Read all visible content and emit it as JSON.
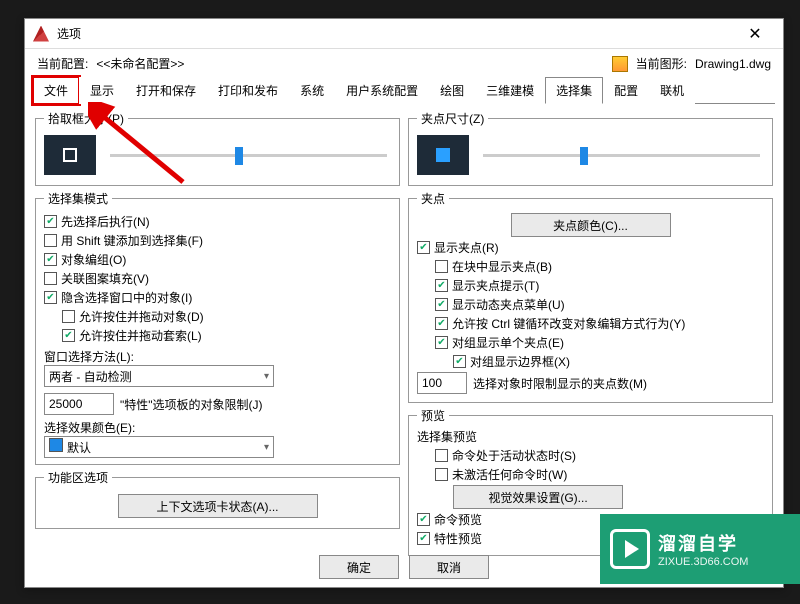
{
  "title": "选项",
  "header": {
    "profile_label": "当前配置:",
    "profile_value": "<<未命名配置>>",
    "drawing_label": "当前图形:",
    "drawing_value": "Drawing1.dwg"
  },
  "tabs": [
    "文件",
    "显示",
    "打开和保存",
    "打印和发布",
    "系统",
    "用户系统配置",
    "绘图",
    "三维建模",
    "选择集",
    "配置",
    "联机"
  ],
  "active_tab": "选择集",
  "highlight_tab": "文件",
  "left": {
    "pickbox_legend": "拾取框大小(P)",
    "mode_legend": "选择集模式",
    "mode_items": [
      {
        "checked": true,
        "label": "先选择后执行(N)"
      },
      {
        "checked": false,
        "label": "用 Shift 键添加到选择集(F)"
      },
      {
        "checked": true,
        "label": "对象编组(O)"
      },
      {
        "checked": false,
        "label": "关联图案填充(V)"
      },
      {
        "checked": true,
        "label": "隐含选择窗口中的对象(I)"
      }
    ],
    "mode_sub": [
      {
        "checked": false,
        "label": "允许按住并拖动对象(D)"
      },
      {
        "checked": true,
        "label": "允许按住并拖动套索(L)"
      }
    ],
    "winsel_label": "窗口选择方法(L):",
    "winsel_value": "两者 - 自动检测",
    "limit_value": "25000",
    "limit_label": "\"特性\"选项板的对象限制(J)",
    "effect_label": "选择效果颜色(E):",
    "effect_value": "默认",
    "ribbon_legend": "功能区选项",
    "ribbon_btn": "上下文选项卡状态(A)..."
  },
  "right": {
    "gripsize_legend": "夹点尺寸(Z)",
    "grip_legend": "夹点",
    "grip_color_btn": "夹点颜色(C)...",
    "grip_items": [
      {
        "checked": true,
        "label": "显示夹点(R)"
      },
      {
        "checked": false,
        "label": "在块中显示夹点(B)",
        "indent": true
      },
      {
        "checked": true,
        "label": "显示夹点提示(T)",
        "indent": true
      },
      {
        "checked": true,
        "label": "显示动态夹点菜单(U)",
        "indent": true
      },
      {
        "checked": true,
        "label": "允许按 Ctrl 键循环改变对象编辑方式行为(Y)",
        "indent": true
      },
      {
        "checked": true,
        "label": "对组显示单个夹点(E)",
        "indent": true
      },
      {
        "checked": true,
        "label": "对组显示边界框(X)",
        "indent": true,
        "extra_indent": true
      }
    ],
    "grip_limit_value": "100",
    "grip_limit_label": "选择对象时限制显示的夹点数(M)",
    "preview_legend": "预览",
    "preview_sub": "选择集预览",
    "preview_items": [
      {
        "checked": false,
        "label": "命令处于活动状态时(S)"
      },
      {
        "checked": false,
        "label": "未激活任何命令时(W)"
      }
    ],
    "visual_btn": "视觉效果设置(G)...",
    "cmd_preview": {
      "checked": true,
      "label": "命令预览"
    },
    "prop_preview": {
      "checked": true,
      "label": "特性预览"
    }
  },
  "footer": {
    "ok": "确定",
    "cancel": "取消"
  },
  "watermark": {
    "brand": "溜溜自学",
    "url": "ZIXUE.3D66.COM"
  }
}
